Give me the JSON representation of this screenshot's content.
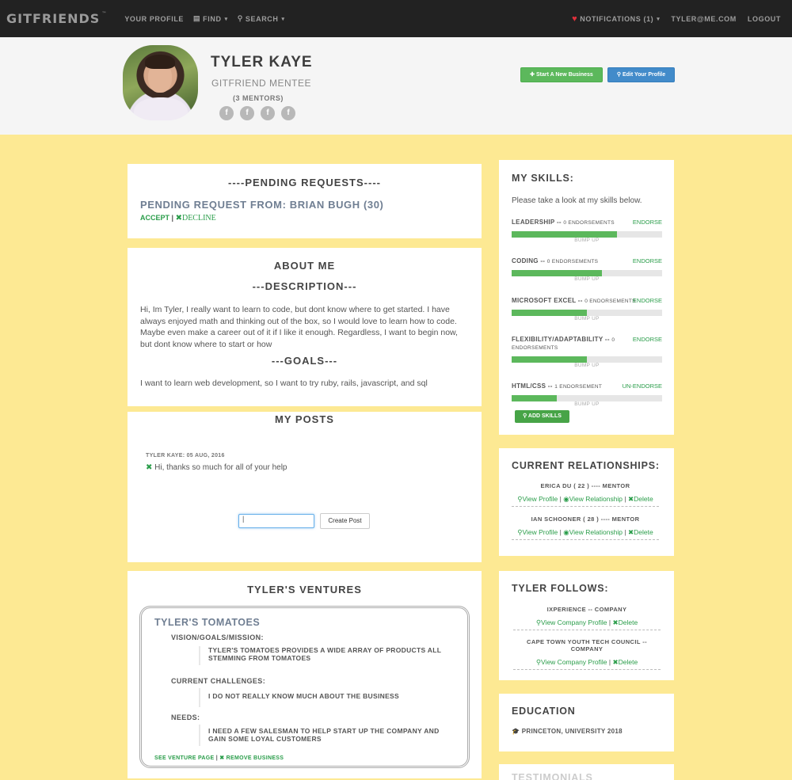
{
  "nav": {
    "brand": "GITFRIENDS",
    "brand_sup": "™",
    "your_profile": "YOUR PROFILE",
    "find": "FIND",
    "search": "SEARCH",
    "notifications": "NOTIFICATIONS (1)",
    "user": "TYLER@ME.COM",
    "logout": "LOGOUT"
  },
  "profile": {
    "name": "TYLER KAYE",
    "role": "GITFRIEND MENTEE",
    "mentors": "(3 MENTORS)",
    "social": [
      "f",
      "f",
      "f",
      "f"
    ],
    "start_business": "Start A New Business",
    "edit_profile": "Edit Your Profile"
  },
  "pending": {
    "title": "----PENDING REQUESTS----",
    "from": "PENDING REQUEST FROM: BRIAN BUGH (30)",
    "accept": "ACCEPT",
    "separator": "|",
    "decline": "DECLINE"
  },
  "about": {
    "title": "ABOUT ME",
    "description_title": "---DESCRIPTION---",
    "description": "Hi, Im Tyler, I really want to learn to code, but dont know where to get started. I have always enjoyed math and thinking out of the box, so I would love to learn how to code. Maybe even make a career out of it if I like it enough. Regardless, I want to begin now, but dont know where to start or how",
    "goals_title": "---GOALS---",
    "goals": "I want to learn web development, so I want to try ruby, rails, javascript, and sql"
  },
  "posts": {
    "title": "MY POSTS",
    "items": [
      {
        "meta": "TYLER KAYE: 05 AUG, 2016",
        "text": "Hi, thanks so much for all of your help"
      }
    ],
    "input_value": "|",
    "button": "Create Post"
  },
  "ventures": {
    "title": "TYLER'S VENTURES",
    "name": "TYLER'S TOMATOES",
    "vision_label": "VISION/GOALS/MISSION:",
    "vision_line1": "TYLER'S TOMATOES PROVIDES A WIDE ARRAY OF PRODUCTS ALL",
    "vision_line2": "STEMMING FROM TOMATOES",
    "challenges_label": "CURRENT CHALLENGES:",
    "challenges": "I DO NOT REALLY KNOW MUCH ABOUT THE BUSINESS",
    "needs_label": "NEEDS:",
    "needs_line1": "I NEED A FEW SALESMAN TO HELP START UP THE COMPANY AND",
    "needs_line2": "GAIN SOME LOYAL CUSTOMERS",
    "see_page": "SEE VENTURE PAGE",
    "separator": "|",
    "remove": "REMOVE BUSINESS"
  },
  "skills": {
    "title": "MY SKILLS:",
    "intro": "Please take a look at my skills below.",
    "bump": "BUMP UP",
    "items": [
      {
        "name": "LEADERSHIP --",
        "count": "0 ENDORSEMENTS",
        "action": "ENDORSE",
        "level": 0.7
      },
      {
        "name": "CODING --",
        "count": "0 ENDORSEMENTS",
        "action": "ENDORSE",
        "level": 0.6
      },
      {
        "name": "MICROSOFT EXCEL --",
        "count": "0 ENDORSEMENTS",
        "action": "ENDORSE",
        "level": 0.5
      },
      {
        "name": "FLEXIBILITY/ADAPTABILITY --",
        "count": "0 ENDORSEMENTS",
        "action": "ENDORSE",
        "level": 0.5
      },
      {
        "name": "HTML/CSS --",
        "count": "1 ENDORSEMENT",
        "action": "UN-ENDORSE",
        "level": 0.3
      }
    ],
    "add": "ADD SKILLS"
  },
  "relationships": {
    "title": "CURRENT RELATIONSHIPS:",
    "items": [
      {
        "name": "ERICA DU ( 22 ) ---- MENTOR",
        "view_profile": "View Profile",
        "view_rel": "View Relationship",
        "delete": "Delete",
        "sep": "|"
      },
      {
        "name": "IAN SCHOONER ( 28 ) ---- MENTOR",
        "view_profile": "View Profile",
        "view_rel": "View Relationship",
        "delete": "Delete",
        "sep": "|"
      }
    ]
  },
  "follows": {
    "title": "TYLER FOLLOWS:",
    "items": [
      {
        "name": "IXPERIENCE -- COMPANY",
        "view": "View Company Profile",
        "delete": "Delete",
        "sep": "|"
      },
      {
        "name": "CAPE TOWN YOUTH TECH COUNCIL -- COMPANY",
        "view": "View Company Profile",
        "delete": "Delete",
        "sep": "|"
      }
    ]
  },
  "education": {
    "title": "EDUCATION",
    "school": "PRINCETON, UNIVERSITY 2018"
  },
  "testimonials": {
    "title": "TESTIMONIALS"
  },
  "colors": {
    "background": "#fde993",
    "navbar": "#222222",
    "accent_green": "#5cb85c",
    "accent_blue": "#428bca",
    "link_green": "#2a9d4a"
  }
}
